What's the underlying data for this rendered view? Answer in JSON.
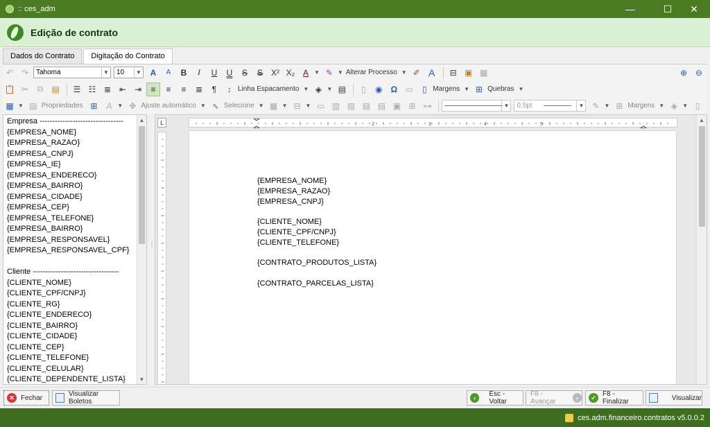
{
  "window": {
    "title": ":: ces_adm",
    "controls": {
      "minimize": "—",
      "maximize": "☐",
      "close": "✕"
    }
  },
  "header": {
    "title": "Edição de contrato"
  },
  "tabs": [
    {
      "label": "Dados do Contrato",
      "active": false
    },
    {
      "label": "Digitação do Contrato",
      "active": true
    }
  ],
  "toolbar": {
    "font_family": "Tahoma",
    "font_size": "10",
    "alterar_processo": "Alterar Processo",
    "linha_espacamento": "Linha Espacamento",
    "margens": "Margens",
    "quebras": "Quebras",
    "propriedades": "Propriedades",
    "ajuste_automatico": "Ajuste automático",
    "selecione": "Selecione",
    "border_width": "0,5pt",
    "margens2": "Margens"
  },
  "left_panel": {
    "items": [
      "Empresa ---------------------------------",
      "{EMPRESA_NOME}",
      "{EMPRESA_RAZAO}",
      "{EMPRESA_CNPJ}",
      "{EMPRESA_IE}",
      "{EMPRESA_ENDERECO}",
      "{EMPRESA_BAIRRO}",
      "{EMPRESA_CIDADE}",
      "{EMPRESA_CEP}",
      "{EMPRESA_TELEFONE}",
      "{EMPRESA_BAIRRO}",
      "{EMPRESA_RESPONSAVEL}",
      "{EMPRESA_RESPONSAVEL_CPF}",
      "",
      "Cliente ----------------------------------",
      "{CLIENTE_NOME}",
      "{CLIENTE_CPF/CNPJ}",
      "{CLIENTE_RG}",
      "{CLIENTE_ENDERECO}",
      "{CLIENTE_BAIRRO}",
      "{CLIENTE_CIDADE}",
      "{CLIENTE_CEP}",
      "{CLIENTE_TELEFONE}",
      "{CLIENTE_CELULAR}",
      "{CLIENTE_DEPENDENTE_LISTA}"
    ]
  },
  "document": {
    "lines": [
      "{EMPRESA_NOME}",
      "{EMPRESA_RAZAO}",
      "{EMPRESA_CNPJ}",
      "",
      "{CLIENTE_NOME}",
      "{CLIENTE_CPF/CNPJ}",
      "{CLIENTE_TELEFONE}",
      "",
      "{CONTRATO_PRODUTOS_LISTA}",
      "",
      "{CONTRATO_PARCELAS_LISTA}"
    ]
  },
  "buttons": {
    "fechar": "Fechar",
    "visualizar_boletos": "Visualizar Boletos",
    "voltar": "Esc - Voltar",
    "avancar": "F8 - Avançar",
    "finalizar": "F8 - Finalizar",
    "visualizar": "Visualizar"
  },
  "status": {
    "text": "ces.adm.financeiro.contratos v5.0.0.2"
  },
  "colors": {
    "title_bar": "#4a7a22",
    "header_bg": "#dcf0d4",
    "status_bar": "#3c6e1e"
  }
}
